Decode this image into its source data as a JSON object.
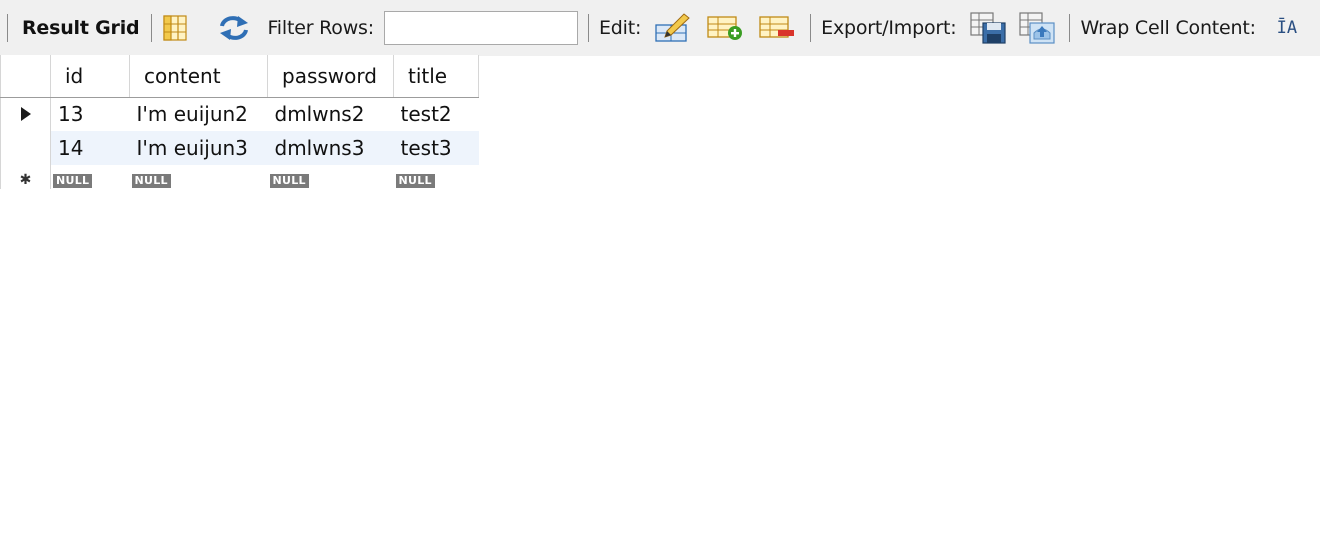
{
  "toolbar": {
    "result_grid_label": "Result Grid",
    "filter_rows_label": "Filter Rows:",
    "filter_rows_value": "",
    "edit_label": "Edit:",
    "export_import_label": "Export/Import:",
    "wrap_cell_label": "Wrap Cell Content:",
    "wrap_icon_glyph": "ĪA"
  },
  "grid": {
    "columns": [
      "id",
      "content",
      "password",
      "title"
    ],
    "rows": [
      {
        "id": "13",
        "content": "I'm euijun2",
        "password": "dmlwns2",
        "title": "test2"
      },
      {
        "id": "14",
        "content": "I'm euijun3",
        "password": "dmlwns3",
        "title": "test3"
      }
    ],
    "null_label": "NULL",
    "new_row_marker": "✱"
  },
  "colors": {
    "toolbar_bg": "#f0f0f0",
    "alt_row_bg": "#eef4fc",
    "null_badge_bg": "#7a7a7a",
    "icon_yellow": "#f2c94c",
    "icon_blue": "#2f6fb5",
    "icon_green": "#3a9d23",
    "icon_red": "#d9342b"
  }
}
